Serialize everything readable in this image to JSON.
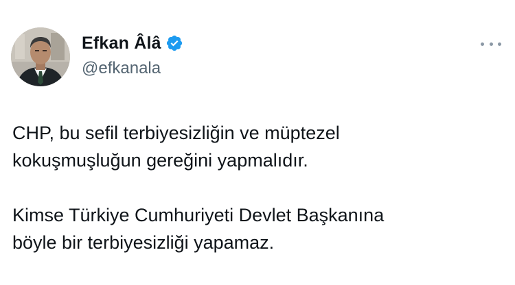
{
  "author": {
    "display_name": "Efkan Âlâ",
    "handle": "@efkanala",
    "verified": true
  },
  "icons": {
    "verified": "verified-badge-icon",
    "more": "more-horizontal-icon"
  },
  "colors": {
    "verified_blue": "#1d9bf0",
    "handle_gray": "#536471",
    "text": "#0f1419"
  },
  "tweet": {
    "paragraphs": [
      {
        "line1": "CHP, bu sefil terbiyesizliğin ve müptezel",
        "line2": "kokuşmuşluğun gereğini yapmalıdır."
      },
      {
        "line1": "Kimse Türkiye Cumhuriyeti Devlet Başkanına",
        "line2": "böyle bir terbiyesizliği yapamaz."
      }
    ]
  }
}
